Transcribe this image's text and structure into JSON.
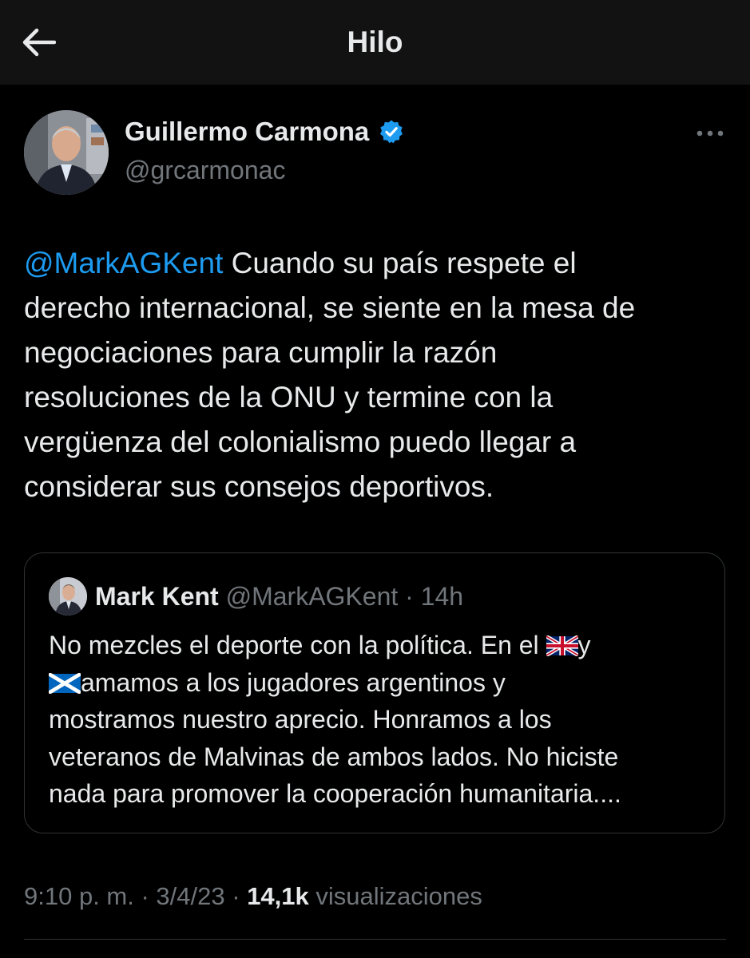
{
  "header": {
    "title": "Hilo",
    "back_icon": "arrow-left-icon"
  },
  "tweet": {
    "author": {
      "name": "Guillermo Carmona",
      "handle": "@grcarmonac",
      "verified": true,
      "verified_color": "#1d9bf0"
    },
    "more_icon": "more-horizontal-icon",
    "mention": "@MarkAGKent",
    "text_lines": [
      " Cuando su país respete el",
      "derecho internacional, se siente en la mesa de",
      "negociaciones para cumplir la razón",
      "resoluciones de la ONU y termine con la",
      "vergüenza del colonialismo puedo llegar a",
      "considerar sus consejos deportivos."
    ],
    "time": "9:10 p. m.",
    "date": "3/4/23",
    "views_count": "14,1k",
    "views_label": "visualizaciones"
  },
  "quoted": {
    "name": "Mark Kent",
    "handle": "@MarkAGKent",
    "time": "14h",
    "line1_a": "No mezcles el deporte con la política.  En el ",
    "line1_flag": "uk-flag-icon",
    "line1_b": "y",
    "line2_flag": "scotland-flag-icon",
    "line2_text": "amamos a los jugadores argentinos y",
    "line3": "mostramos nuestro aprecio. Honramos a los",
    "line4": "veteranos de Malvinas de ambos lados. No hiciste",
    "line5": "nada para promover la cooperación humanitaria...."
  },
  "colors": {
    "background": "#000000",
    "topbar": "#121212",
    "text": "#e7e9ea",
    "secondary": "#71767b",
    "accent": "#1d9bf0",
    "border": "#2f3336"
  }
}
